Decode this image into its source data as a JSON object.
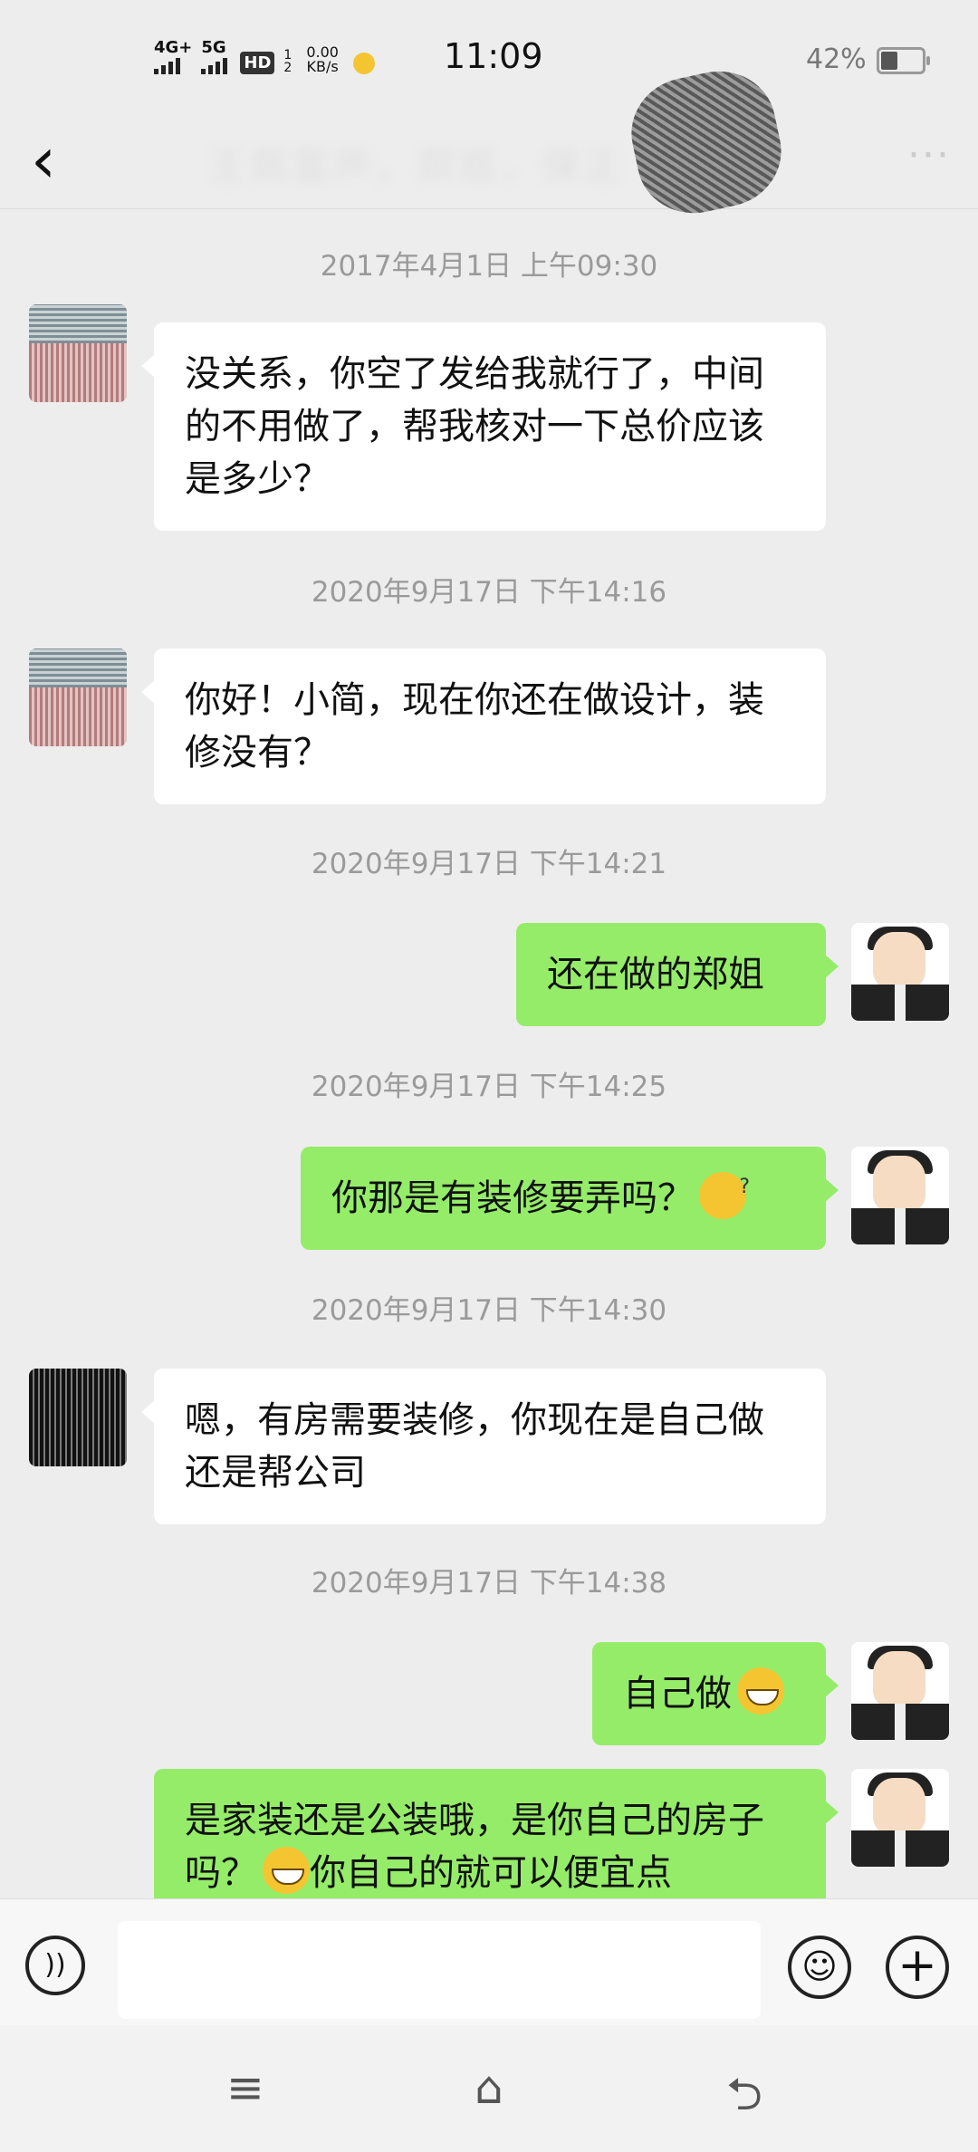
{
  "status_bar": {
    "net1": "4G+",
    "net2": "5G",
    "hd": "HD",
    "hd_top": "1",
    "hd_bottom": "2",
    "speed_value": "0.00",
    "speed_unit": "KB/s",
    "time": "11:09",
    "battery": "42%"
  },
  "header": {
    "back_icon": "chevron-left-icon",
    "title": "王佩富声，郑姐，保正",
    "more_icon": "ellipsis-icon"
  },
  "messages": [
    {
      "type": "timestamp",
      "text": "2017年4月1日 上午09:30"
    },
    {
      "type": "bubble",
      "side": "left",
      "text": "没关系，你空了发给我就行了，中间的不用做了，帮我核对一下总价应该是多少？"
    },
    {
      "type": "timestamp",
      "text": "2020年9月17日 下午14:16"
    },
    {
      "type": "bubble",
      "side": "left",
      "text": "你好！小简，现在你还在做设计，装修没有？"
    },
    {
      "type": "timestamp",
      "text": "2020年9月17日 下午14:21"
    },
    {
      "type": "bubble",
      "side": "right",
      "text": "还在做的郑姐"
    },
    {
      "type": "timestamp",
      "text": "2020年9月17日 下午14:25"
    },
    {
      "type": "bubble",
      "side": "right",
      "text": "你那是有装修要弄吗？",
      "emoji": "thinking-face"
    },
    {
      "type": "timestamp",
      "text": "2020年9月17日 下午14:30"
    },
    {
      "type": "bubble",
      "side": "left",
      "text": "嗯，有房需要装修，你现在是自己做还是帮公司"
    },
    {
      "type": "timestamp",
      "text": "2020年9月17日 下午14:38"
    },
    {
      "type": "bubble",
      "side": "right",
      "text": "自己做",
      "emoji": "grinning-face"
    },
    {
      "type": "bubble",
      "side": "right",
      "text_a": "是家装还是公装哦，是你自己的房子吗？",
      "text_b": "你自己的就可以便宜点",
      "emoji": "grinning-face"
    }
  ],
  "input_bar": {
    "voice_icon": "voice-icon",
    "emoji_icon": "smile-icon",
    "plus_icon": "plus-icon"
  },
  "nav_bar": {
    "menu_icon": "menu-icon",
    "home_icon": "home-icon",
    "back_icon": "back-icon"
  }
}
